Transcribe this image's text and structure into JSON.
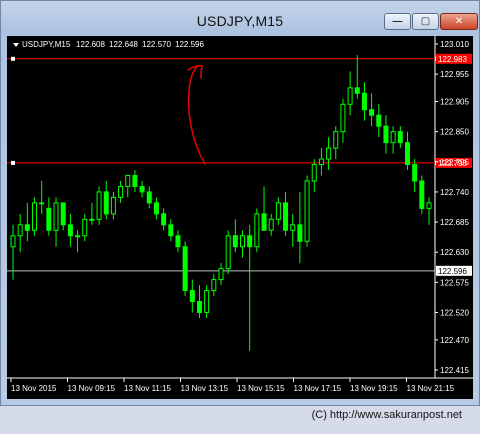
{
  "window": {
    "title": "USDJPY,M15",
    "buttons": {
      "minimize": "—",
      "maximize": "▢",
      "close": "✕"
    }
  },
  "credit": "(C) http://www.sakuranpost.net",
  "chart_data": {
    "type": "candlestick",
    "symbol_line": {
      "symbol": "USDJPY,M15",
      "open": "122.608",
      "high": "122.648",
      "low": "122.570",
      "close": "122.596"
    },
    "y_ticks": [
      "123.010",
      "122.955",
      "122.905",
      "122.850",
      "122.795",
      "122.740",
      "122.685",
      "122.630",
      "122.575",
      "122.520",
      "122.470",
      "122.415"
    ],
    "ylim": [
      122.415,
      123.01
    ],
    "x_ticks": [
      "13 Nov 2015",
      "13 Nov 09:15",
      "13 Nov 11:15",
      "13 Nov 13:15",
      "13 Nov 15:15",
      "13 Nov 17:15",
      "13 Nov 19:15",
      "13 Nov 21:15"
    ],
    "horizontal_lines": [
      {
        "value": 122.983,
        "label": "122.983",
        "color": "#ff0000"
      },
      {
        "value": 122.793,
        "label": "122.793",
        "color": "#ff0000"
      },
      {
        "value": 122.596,
        "label": "122.596",
        "color": "#c0c0c0"
      }
    ],
    "up_color": "#00ff00",
    "down_color": "#00ff00",
    "annotation_color": "#e00000",
    "candles": [
      {
        "o": 122.64,
        "h": 122.68,
        "l": 122.58,
        "c": 122.66
      },
      {
        "o": 122.66,
        "h": 122.7,
        "l": 122.63,
        "c": 122.68
      },
      {
        "o": 122.68,
        "h": 122.72,
        "l": 122.65,
        "c": 122.67
      },
      {
        "o": 122.67,
        "h": 122.73,
        "l": 122.66,
        "c": 122.72
      },
      {
        "o": 122.72,
        "h": 122.76,
        "l": 122.7,
        "c": 122.72
      },
      {
        "o": 122.71,
        "h": 122.73,
        "l": 122.66,
        "c": 122.67
      },
      {
        "o": 122.67,
        "h": 122.73,
        "l": 122.64,
        "c": 122.72
      },
      {
        "o": 122.72,
        "h": 122.72,
        "l": 122.67,
        "c": 122.68
      },
      {
        "o": 122.68,
        "h": 122.7,
        "l": 122.64,
        "c": 122.66
      },
      {
        "o": 122.66,
        "h": 122.67,
        "l": 122.63,
        "c": 122.66
      },
      {
        "o": 122.66,
        "h": 122.7,
        "l": 122.65,
        "c": 122.69
      },
      {
        "o": 122.69,
        "h": 122.72,
        "l": 122.68,
        "c": 122.69
      },
      {
        "o": 122.69,
        "h": 122.75,
        "l": 122.68,
        "c": 122.74
      },
      {
        "o": 122.74,
        "h": 122.76,
        "l": 122.69,
        "c": 122.7
      },
      {
        "o": 122.7,
        "h": 122.74,
        "l": 122.69,
        "c": 122.73
      },
      {
        "o": 122.73,
        "h": 122.76,
        "l": 122.72,
        "c": 122.75
      },
      {
        "o": 122.75,
        "h": 122.77,
        "l": 122.73,
        "c": 122.77
      },
      {
        "o": 122.77,
        "h": 122.78,
        "l": 122.74,
        "c": 122.75
      },
      {
        "o": 122.75,
        "h": 122.76,
        "l": 122.73,
        "c": 122.74
      },
      {
        "o": 122.74,
        "h": 122.75,
        "l": 122.71,
        "c": 122.72
      },
      {
        "o": 122.72,
        "h": 122.73,
        "l": 122.69,
        "c": 122.7
      },
      {
        "o": 122.7,
        "h": 122.71,
        "l": 122.67,
        "c": 122.68
      },
      {
        "o": 122.68,
        "h": 122.69,
        "l": 122.65,
        "c": 122.66
      },
      {
        "o": 122.66,
        "h": 122.67,
        "l": 122.63,
        "c": 122.64
      },
      {
        "o": 122.64,
        "h": 122.65,
        "l": 122.55,
        "c": 122.56
      },
      {
        "o": 122.56,
        "h": 122.58,
        "l": 122.52,
        "c": 122.54
      },
      {
        "o": 122.54,
        "h": 122.57,
        "l": 122.51,
        "c": 122.52
      },
      {
        "o": 122.52,
        "h": 122.57,
        "l": 122.51,
        "c": 122.56
      },
      {
        "o": 122.56,
        "h": 122.59,
        "l": 122.55,
        "c": 122.58
      },
      {
        "o": 122.58,
        "h": 122.61,
        "l": 122.57,
        "c": 122.6
      },
      {
        "o": 122.6,
        "h": 122.67,
        "l": 122.59,
        "c": 122.66
      },
      {
        "o": 122.66,
        "h": 122.69,
        "l": 122.63,
        "c": 122.64
      },
      {
        "o": 122.64,
        "h": 122.67,
        "l": 122.62,
        "c": 122.66
      },
      {
        "o": 122.66,
        "h": 122.68,
        "l": 122.45,
        "c": 122.64
      },
      {
        "o": 122.64,
        "h": 122.71,
        "l": 122.63,
        "c": 122.7
      },
      {
        "o": 122.7,
        "h": 122.75,
        "l": 122.68,
        "c": 122.67
      },
      {
        "o": 122.67,
        "h": 122.7,
        "l": 122.66,
        "c": 122.69
      },
      {
        "o": 122.69,
        "h": 122.73,
        "l": 122.68,
        "c": 122.72
      },
      {
        "o": 122.72,
        "h": 122.74,
        "l": 122.66,
        "c": 122.67
      },
      {
        "o": 122.67,
        "h": 122.7,
        "l": 122.64,
        "c": 122.68
      },
      {
        "o": 122.68,
        "h": 122.74,
        "l": 122.61,
        "c": 122.65
      },
      {
        "o": 122.65,
        "h": 122.77,
        "l": 122.64,
        "c": 122.76
      },
      {
        "o": 122.76,
        "h": 122.8,
        "l": 122.74,
        "c": 122.79
      },
      {
        "o": 122.79,
        "h": 122.82,
        "l": 122.77,
        "c": 122.8
      },
      {
        "o": 122.8,
        "h": 122.84,
        "l": 122.78,
        "c": 122.82
      },
      {
        "o": 122.82,
        "h": 122.86,
        "l": 122.8,
        "c": 122.85
      },
      {
        "o": 122.85,
        "h": 122.91,
        "l": 122.83,
        "c": 122.9
      },
      {
        "o": 122.9,
        "h": 122.96,
        "l": 122.88,
        "c": 122.93
      },
      {
        "o": 122.93,
        "h": 122.99,
        "l": 122.91,
        "c": 122.92
      },
      {
        "o": 122.92,
        "h": 122.94,
        "l": 122.87,
        "c": 122.89
      },
      {
        "o": 122.89,
        "h": 122.92,
        "l": 122.86,
        "c": 122.88
      },
      {
        "o": 122.88,
        "h": 122.9,
        "l": 122.84,
        "c": 122.86
      },
      {
        "o": 122.86,
        "h": 122.88,
        "l": 122.81,
        "c": 122.83
      },
      {
        "o": 122.83,
        "h": 122.86,
        "l": 122.81,
        "c": 122.85
      },
      {
        "o": 122.85,
        "h": 122.86,
        "l": 122.82,
        "c": 122.83
      },
      {
        "o": 122.83,
        "h": 122.85,
        "l": 122.78,
        "c": 122.79
      },
      {
        "o": 122.79,
        "h": 122.8,
        "l": 122.74,
        "c": 122.76
      },
      {
        "o": 122.76,
        "h": 122.77,
        "l": 122.7,
        "c": 122.71
      },
      {
        "o": 122.71,
        "h": 122.73,
        "l": 122.68,
        "c": 122.72
      }
    ]
  }
}
